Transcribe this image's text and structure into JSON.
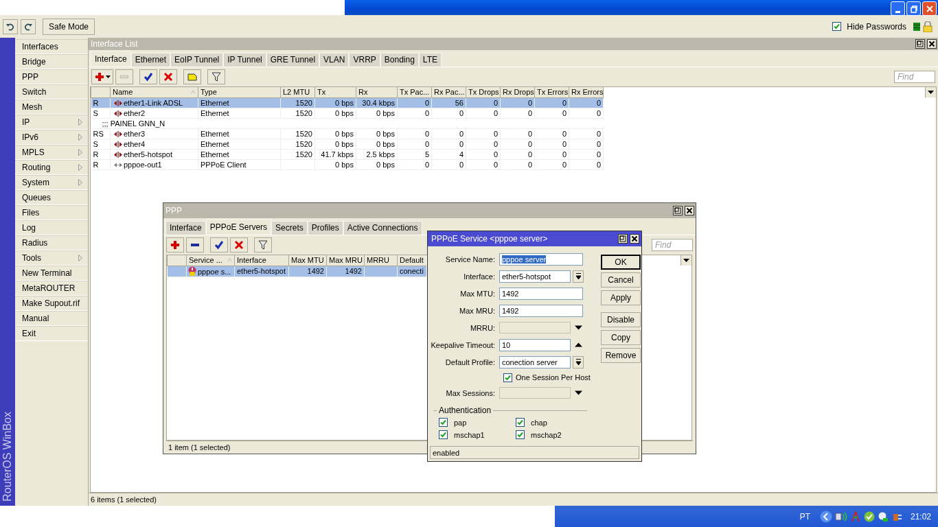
{
  "toolbar": {
    "safe_mode": "Safe Mode",
    "hide_passwords": {
      "label": "Hide Passwords",
      "checked": true
    }
  },
  "sidebar": {
    "brand": "RouterOS WinBox",
    "items": [
      {
        "label": "Interfaces",
        "submenu": false
      },
      {
        "label": "Bridge",
        "submenu": false
      },
      {
        "label": "PPP",
        "submenu": false
      },
      {
        "label": "Switch",
        "submenu": false
      },
      {
        "label": "Mesh",
        "submenu": false
      },
      {
        "label": "IP",
        "submenu": true
      },
      {
        "label": "IPv6",
        "submenu": true
      },
      {
        "label": "MPLS",
        "submenu": true
      },
      {
        "label": "Routing",
        "submenu": true
      },
      {
        "label": "System",
        "submenu": true
      },
      {
        "label": "Queues",
        "submenu": false
      },
      {
        "label": "Files",
        "submenu": false
      },
      {
        "label": "Log",
        "submenu": false
      },
      {
        "label": "Radius",
        "submenu": false
      },
      {
        "label": "Tools",
        "submenu": true
      },
      {
        "label": "New Terminal",
        "submenu": false
      },
      {
        "label": "MetaROUTER",
        "submenu": false
      },
      {
        "label": "Make Supout.rif",
        "submenu": false
      },
      {
        "label": "Manual",
        "submenu": false
      },
      {
        "label": "Exit",
        "submenu": false
      }
    ]
  },
  "interface_list": {
    "title": "Interface List",
    "tabs": [
      {
        "label": "Interface",
        "selected": true
      },
      {
        "label": "Ethernet",
        "selected": false
      },
      {
        "label": "EoIP Tunnel",
        "selected": false
      },
      {
        "label": "IP Tunnel",
        "selected": false
      },
      {
        "label": "GRE Tunnel",
        "selected": false
      },
      {
        "label": "VLAN",
        "selected": false
      },
      {
        "label": "VRRP",
        "selected": false
      },
      {
        "label": "Bonding",
        "selected": false
      },
      {
        "label": "LTE",
        "selected": false
      }
    ],
    "toolbar": {
      "remove_disabled": true
    },
    "find": {
      "placeholder": "Find"
    },
    "columns": [
      "Name",
      "Type",
      "L2 MTU",
      "Tx",
      "Rx",
      "Tx Pac...",
      "Rx Pac...",
      "Tx Drops",
      "Rx Drops",
      "Tx Errors",
      "Rx Errors"
    ],
    "rows": [
      {
        "kind": "ethernet",
        "flags": "R",
        "name": "ether1-Link ADSL",
        "type": "Ethernet",
        "l2_mtu": "1520",
        "tx": "0 bps",
        "rx": "30.4 kbps",
        "tx_packets": "0",
        "rx_packets": "56",
        "tx_drops": "0",
        "rx_drops": "0",
        "tx_errors": "0",
        "rx_errors": "0",
        "selected": true
      },
      {
        "kind": "ethernet",
        "flags": "S",
        "name": "ether2",
        "type": "Ethernet",
        "l2_mtu": "1520",
        "tx": "0 bps",
        "rx": "0 bps",
        "tx_packets": "0",
        "rx_packets": "0",
        "tx_drops": "0",
        "rx_drops": "0",
        "tx_errors": "0",
        "rx_errors": "0",
        "selected": false
      },
      {
        "kind": "comment",
        "text": ";;; PAINEL GNN_N",
        "selected": false
      },
      {
        "kind": "ethernet",
        "flags": "RS",
        "name": "ether3",
        "type": "Ethernet",
        "l2_mtu": "1520",
        "tx": "0 bps",
        "rx": "0 bps",
        "tx_packets": "0",
        "rx_packets": "0",
        "tx_drops": "0",
        "rx_drops": "0",
        "tx_errors": "0",
        "rx_errors": "0",
        "selected": false
      },
      {
        "kind": "ethernet",
        "flags": "S",
        "name": "ether4",
        "type": "Ethernet",
        "l2_mtu": "1520",
        "tx": "0 bps",
        "rx": "0 bps",
        "tx_packets": "0",
        "rx_packets": "0",
        "tx_drops": "0",
        "rx_drops": "0",
        "tx_errors": "0",
        "rx_errors": "0",
        "selected": false
      },
      {
        "kind": "ethernet",
        "flags": "R",
        "name": "ether5-hotspot",
        "type": "Ethernet",
        "l2_mtu": "1520",
        "tx": "41.7 kbps",
        "rx": "2.5 kbps",
        "tx_packets": "5",
        "rx_packets": "4",
        "tx_drops": "0",
        "rx_drops": "0",
        "tx_errors": "0",
        "rx_errors": "0",
        "selected": false
      },
      {
        "kind": "pppoe",
        "flags": "R",
        "name": "pppoe-out1",
        "type": "PPPoE Client",
        "tx": "0 bps",
        "rx": "0 bps",
        "tx_packets": "0",
        "rx_packets": "0",
        "tx_drops": "0",
        "rx_drops": "0",
        "tx_errors": "0",
        "rx_errors": "0",
        "selected": false
      }
    ],
    "status": "6 items (1 selected)"
  },
  "ppp_window": {
    "title": "PPP",
    "tabs": [
      {
        "label": "Interface",
        "selected": false
      },
      {
        "label": "PPPoE Servers",
        "selected": true
      },
      {
        "label": "Secrets",
        "selected": false
      },
      {
        "label": "Profiles",
        "selected": false
      },
      {
        "label": "Active Connections",
        "selected": false
      }
    ],
    "toolbar": {
      "remove_disabled": false
    },
    "find": {
      "placeholder": "Find"
    },
    "columns": [
      "Service ...",
      "Interface",
      "Max MTU",
      "Max MRU",
      "MRRU",
      "Default"
    ],
    "rows": [
      {
        "kind": "pppoe_server",
        "service": "pppoe s...",
        "interface": "ether5-hotspot",
        "max_mtu": "1492",
        "max_mru": "1492",
        "default_profile": "conecti",
        "selected": true
      }
    ],
    "status": "1 item (1 selected)"
  },
  "dialog": {
    "title": "PPPoE Service <pppoe server>",
    "fields": [
      {
        "kind": "text",
        "label": "Service Name:",
        "value": "pppoe server",
        "highlighted": true
      },
      {
        "kind": "dropdown",
        "label": "Interface:",
        "value": "ether5-hotspot"
      },
      {
        "kind": "text",
        "label": "Max MTU:",
        "value": "1492",
        "highlighted": false
      },
      {
        "kind": "text",
        "label": "Max MRU:",
        "value": "1492",
        "highlighted": false
      },
      {
        "kind": "combo",
        "label": "MRRU:",
        "disabled": true
      },
      {
        "kind": "spin",
        "label": "Keepalive Timeout:",
        "value": "10"
      },
      {
        "kind": "dropdown",
        "label": "Default Profile:",
        "value": "conection server"
      },
      {
        "kind": "checkbox",
        "label": "One Session Per Host",
        "checked": true
      },
      {
        "kind": "combo",
        "label": "Max Sessions:",
        "disabled": true
      }
    ],
    "authentication": {
      "title": "Authentication",
      "options": [
        {
          "label": "pap",
          "checked": true
        },
        {
          "label": "chap",
          "checked": true
        },
        {
          "label": "mschap1",
          "checked": true
        },
        {
          "label": "mschap2",
          "checked": true
        }
      ]
    },
    "buttons": [
      {
        "label": "OK",
        "default": true
      },
      {
        "label": "Cancel",
        "default": false
      },
      {
        "label": "Apply",
        "default": false
      },
      {
        "label": "Disable",
        "default": false
      },
      {
        "label": "Copy",
        "default": false
      },
      {
        "label": "Remove",
        "default": false
      }
    ],
    "status": "enabled"
  },
  "taskbar": {
    "language": "PT",
    "clock": "21:02"
  }
}
